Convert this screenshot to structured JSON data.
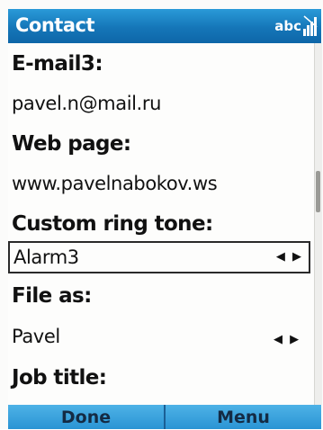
{
  "header": {
    "title": "Contact",
    "input_mode": "abc",
    "signal_icon": "signal-strength-icon"
  },
  "fields": [
    {
      "label": "E-mail3:",
      "value": "pavel.n@mail.ru"
    },
    {
      "label": "Web page:",
      "value": "www.pavelnabokov.ws"
    },
    {
      "label": "Custom ring tone:",
      "value": "Alarm3"
    },
    {
      "label": "File as:",
      "value": "Pavel"
    },
    {
      "label": "Job title:"
    }
  ],
  "softkeys": {
    "left": "Done",
    "right": "Menu"
  },
  "icons": {
    "picker_arrows": "left-right-arrows-icon"
  },
  "colors": {
    "titlebar": "#1576b8",
    "softkey_bar": "#3aa2dc",
    "text": "#111111"
  }
}
